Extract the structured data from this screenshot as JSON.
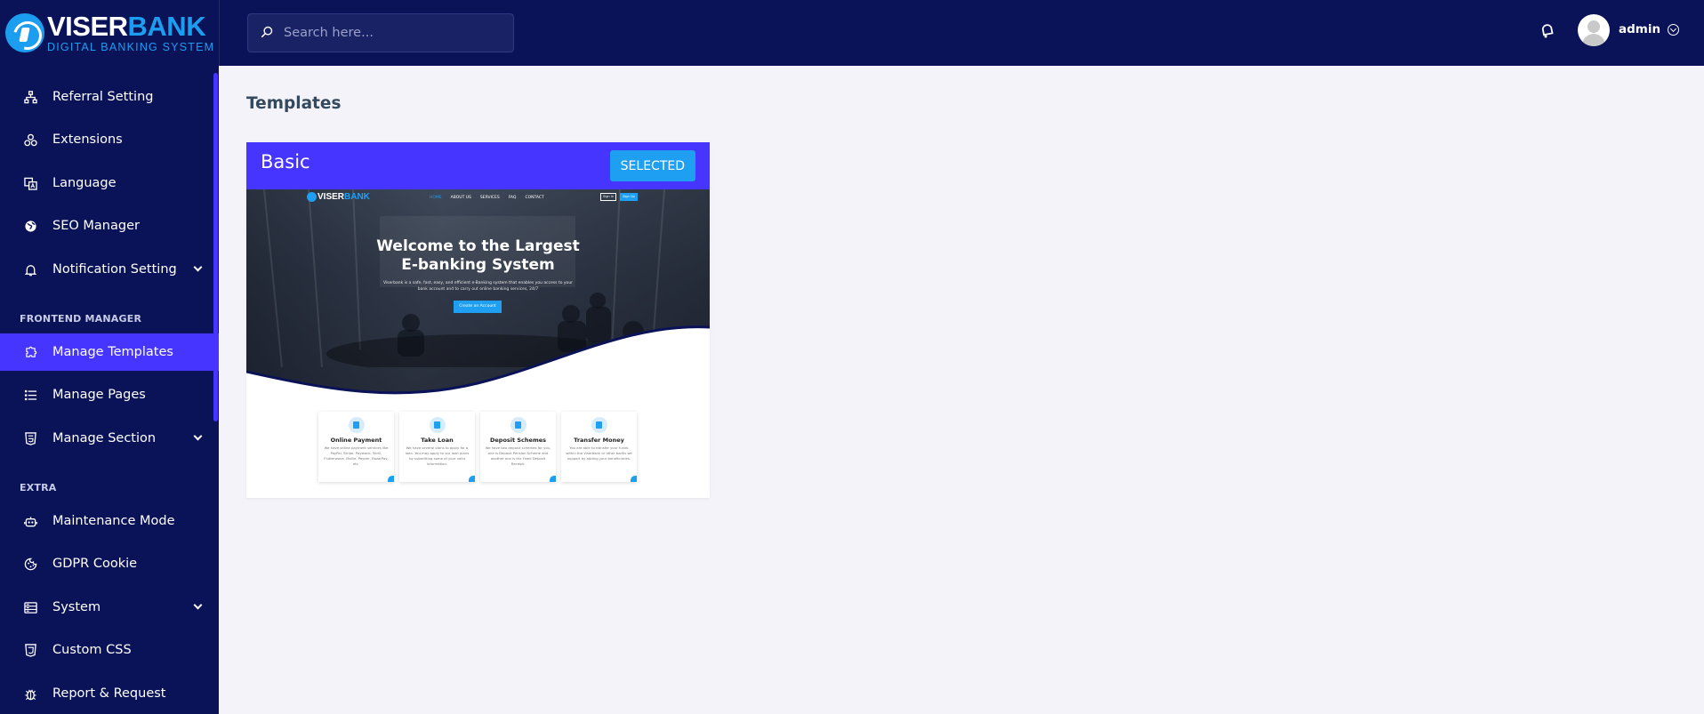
{
  "brand": {
    "name_white": "VISER",
    "name_blue": "BANK",
    "tagline": "DIGITAL BANKING SYSTEM"
  },
  "search": {
    "placeholder": "Search here..."
  },
  "user": {
    "name": "admin"
  },
  "sidebar": {
    "items": [
      {
        "label": "Referral Setting",
        "icon": "sitemap-icon"
      },
      {
        "label": "Extensions",
        "icon": "cogs-icon"
      },
      {
        "label": "Language",
        "icon": "language-icon"
      },
      {
        "label": "SEO Manager",
        "icon": "globe-icon"
      },
      {
        "label": "Notification Setting",
        "icon": "bell-icon",
        "has_submenu": true
      }
    ],
    "frontend_heading": "FRONTEND MANAGER",
    "frontend_items": [
      {
        "label": "Manage Templates",
        "icon": "puzzle-icon",
        "active": true
      },
      {
        "label": "Manage Pages",
        "icon": "list-icon"
      },
      {
        "label": "Manage Section",
        "icon": "html5-icon",
        "has_submenu": true
      }
    ],
    "extra_heading": "EXTRA",
    "extra_items": [
      {
        "label": "Maintenance Mode",
        "icon": "robot-icon"
      },
      {
        "label": "GDPR Cookie",
        "icon": "cookie-icon"
      },
      {
        "label": "System",
        "icon": "server-icon",
        "has_submenu": true
      },
      {
        "label": "Custom CSS",
        "icon": "css3-icon"
      },
      {
        "label": "Report & Request",
        "icon": "bug-icon"
      }
    ]
  },
  "main": {
    "page_title": "Templates",
    "template": {
      "name": "Basic",
      "status_label": "SELECTED",
      "preview": {
        "logo_white": "VISER",
        "logo_blue": "BANK",
        "nav_links": [
          "HOME",
          "ABOUT US",
          "SERVICES",
          "FAQ",
          "CONTACT"
        ],
        "sign_in": "Sign In",
        "sign_up": "Sign Up",
        "headline_line1": "Welcome to the Largest",
        "headline_line2": "E-banking System",
        "subtext": "Viserbank is a safe, fast, easy, and efficient e-Banking system that enables you access to your bank account and to carry out online banking services, 24/7",
        "cta": "Create an Account",
        "services": [
          {
            "title": "Online Payment",
            "text": "We have online payment services like PayPal, Stripe, Paystack, Skrill, Flutterwave, Mollie, Payeer, RazorPay, etc."
          },
          {
            "title": "Take Loan",
            "text": "We have several plans to apply for a loan. You may apply to our loan plans by submitting some of your valid information."
          },
          {
            "title": "Deposit Schemes",
            "text": "We have two deposit schemes for you, one is Deposit Pension Scheme and another one is the Fixed Deposit Receipt."
          },
          {
            "title": "Transfer Money",
            "text": "You are able to transfer your funds within the Viserbank or other banks we support by adding your beneficiaries."
          }
        ]
      }
    }
  },
  "colors": {
    "sidebar_bg": "#0b1358",
    "accent": "#4634ff",
    "info": "#1e9ff2",
    "page_bg": "#f3f3f9"
  }
}
